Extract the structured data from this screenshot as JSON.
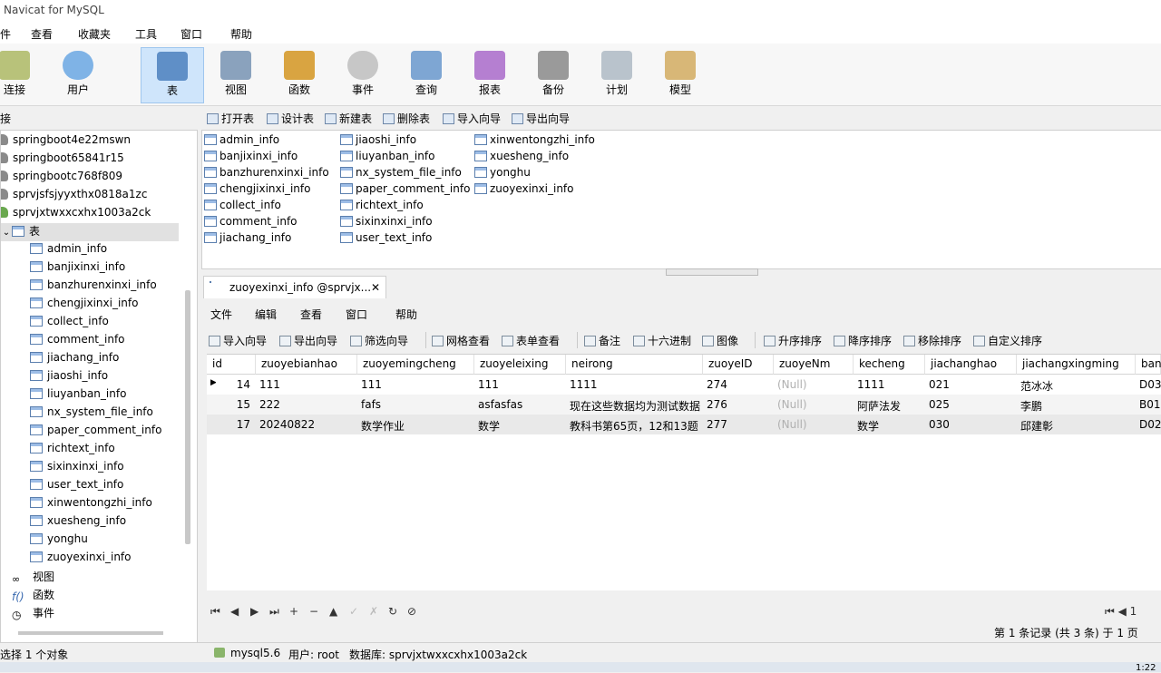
{
  "window": {
    "title": "Navicat for MySQL"
  },
  "menu": [
    "件",
    "查看",
    "收藏夹",
    "工具",
    "窗口",
    "帮助"
  ],
  "toolbar": [
    {
      "label": "连接",
      "icon": "connection-icon"
    },
    {
      "label": "用户",
      "icon": "user-icon"
    },
    {
      "label": "表",
      "icon": "table-icon",
      "active": true
    },
    {
      "label": "视图",
      "icon": "view-icon"
    },
    {
      "label": "函数",
      "icon": "function-icon"
    },
    {
      "label": "事件",
      "icon": "event-icon"
    },
    {
      "label": "查询",
      "icon": "query-icon"
    },
    {
      "label": "报表",
      "icon": "report-icon"
    },
    {
      "label": "备份",
      "icon": "backup-icon"
    },
    {
      "label": "计划",
      "icon": "schedule-icon"
    },
    {
      "label": "模型",
      "icon": "model-icon"
    }
  ],
  "left_panel": {
    "header": "接"
  },
  "tree": {
    "databases": [
      "springboot4e22mswn",
      "springboot65841r15",
      "springbootc768f809",
      "sprvjsfsjyyxthx0818a1zc",
      "sprvjxtwxxcxhx1003a2ck"
    ],
    "tables_node": "表",
    "tables": [
      "admin_info",
      "banjixinxi_info",
      "banzhurenxinxi_info",
      "chengjixinxi_info",
      "collect_info",
      "comment_info",
      "jiachang_info",
      "jiaoshi_info",
      "liuyanban_info",
      "nx_system_file_info",
      "paper_comment_info",
      "richtext_info",
      "sixinxinxi_info",
      "user_text_info",
      "xinwentongzhi_info",
      "xuesheng_info",
      "yonghu",
      "zuoyexinxi_info"
    ],
    "other_nodes": [
      "视图",
      "函数",
      "事件"
    ]
  },
  "object_toolbar": [
    "打开表",
    "设计表",
    "新建表",
    "删除表",
    "导入向导",
    "导出向导"
  ],
  "object_list": {
    "col1": [
      "admin_info",
      "banjixinxi_info",
      "banzhurenxinxi_info",
      "chengjixinxi_info",
      "collect_info",
      "comment_info",
      "jiachang_info"
    ],
    "col2": [
      "jiaoshi_info",
      "liuyanban_info",
      "nx_system_file_info",
      "paper_comment_info",
      "richtext_info",
      "sixinxinxi_info",
      "user_text_info"
    ],
    "col3": [
      "xinwentongzhi_info",
      "xuesheng_info",
      "yonghu",
      "zuoyexinxi_info"
    ]
  },
  "editor": {
    "tab_title": "zuoyexinxi_info @sprvjx...",
    "close": "✕",
    "menu": [
      "文件",
      "编辑",
      "查看",
      "窗口",
      "帮助"
    ],
    "toolbar": [
      "导入向导",
      "导出向导",
      "筛选向导",
      "网格查看",
      "表单查看",
      "备注",
      "十六进制",
      "图像",
      "升序排序",
      "降序排序",
      "移除排序",
      "自定义排序"
    ]
  },
  "grid": {
    "columns": [
      "id",
      "zuoyebianhao",
      "zuoyemingcheng",
      "zuoyeleixing",
      "neirong",
      "zuoyeID",
      "zuoyeNm",
      "kecheng",
      "jiachanghao",
      "jiachangxingming",
      "ban"
    ],
    "rows": [
      [
        "14",
        "111",
        "111",
        "111",
        "1111",
        "274",
        "(Null)",
        "1111",
        "021",
        "范冰冰",
        "D03"
      ],
      [
        "15",
        "222",
        "fafs",
        "asfasfas",
        "现在这些数据均为测试数据",
        "276",
        "(Null)",
        "阿萨法发",
        "025",
        "李鹏",
        "B01"
      ],
      [
        "17",
        "20240822",
        "数学作业",
        "数学",
        "教科书第65页，12和13题",
        "277",
        "(Null)",
        "数学",
        "030",
        "邱建彰",
        "D02"
      ]
    ],
    "current_row_marker": "▶"
  },
  "nav": [
    "⏮",
    "◀",
    "▶",
    "⏭",
    "+",
    "−",
    "▲",
    "✓",
    "✗",
    "↻",
    "⊘"
  ],
  "nav_right": "⏮ ◀ 1",
  "record_info": "第 1 条记录 (共 3 条) 于 1 页",
  "status": {
    "left": "选择 1 个对象",
    "server": "mysql5.6",
    "user": "用户: root",
    "database": "数据库: sprvjxtwxxcxhx1003a2ck"
  },
  "clock": "1:22"
}
